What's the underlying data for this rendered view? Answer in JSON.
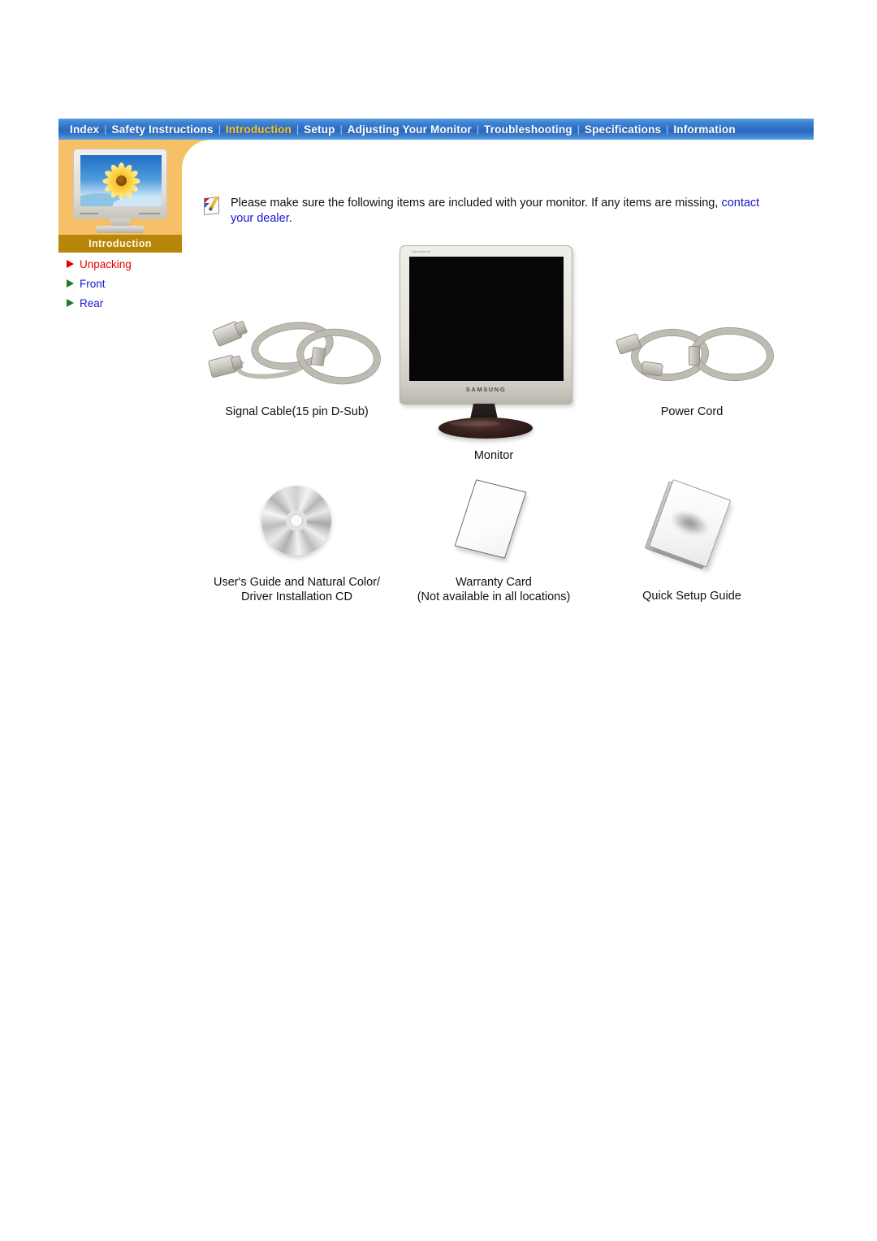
{
  "nav": {
    "items": [
      {
        "label": "Index",
        "active": false
      },
      {
        "label": "Safety Instructions",
        "active": false
      },
      {
        "label": "Introduction",
        "active": true
      },
      {
        "label": "Setup",
        "active": false
      },
      {
        "label": "Adjusting Your Monitor",
        "active": false
      },
      {
        "label": "Troubleshooting",
        "active": false
      },
      {
        "label": "Specifications",
        "active": false
      },
      {
        "label": "Information",
        "active": false
      }
    ],
    "separator": "|",
    "active_color": "#ffc425",
    "text_color": "#ffffff",
    "bar_color": "#2e6fc4"
  },
  "sidebar": {
    "section_title": "Introduction",
    "band_color": "#b8860b",
    "panel_color": "#f8c066",
    "thumbnail_name": "monitor-sunflower-thumbnail",
    "links": [
      {
        "label": "Unpacking",
        "current": true,
        "arrow_color": "#e00000"
      },
      {
        "label": "Front",
        "current": false,
        "arrow_color": "#1f7a1f"
      },
      {
        "label": "Rear",
        "current": false,
        "arrow_color": "#1f7a1f"
      }
    ],
    "link_color": "#1515cd",
    "current_link_color": "#e00000"
  },
  "note": {
    "icon_name": "note-pencil-icon",
    "text_before": "Please make sure the following items are included with your monitor. If any items are missing, ",
    "link_text": "contact your dealer",
    "text_after": ".",
    "link_color": "#1515cd"
  },
  "items": {
    "signal_cable": {
      "label": "Signal Cable(15 pin D-Sub)",
      "icon_name": "signal-cable-image"
    },
    "monitor": {
      "label": "Monitor",
      "icon_name": "monitor-image",
      "brand": "SAMSUNG",
      "bezel_text": "SyncMaster"
    },
    "power_cord": {
      "label": "Power Cord",
      "icon_name": "power-cord-image"
    },
    "cd": {
      "label": "User's Guide and Natural Color/\nDriver Installation CD",
      "icon_name": "cd-disc-image"
    },
    "warranty_card": {
      "label": "Warranty Card\n(Not available in all locations)",
      "icon_name": "warranty-card-image"
    },
    "quick_setup": {
      "label": "Quick Setup Guide",
      "icon_name": "quick-setup-guide-image"
    }
  }
}
